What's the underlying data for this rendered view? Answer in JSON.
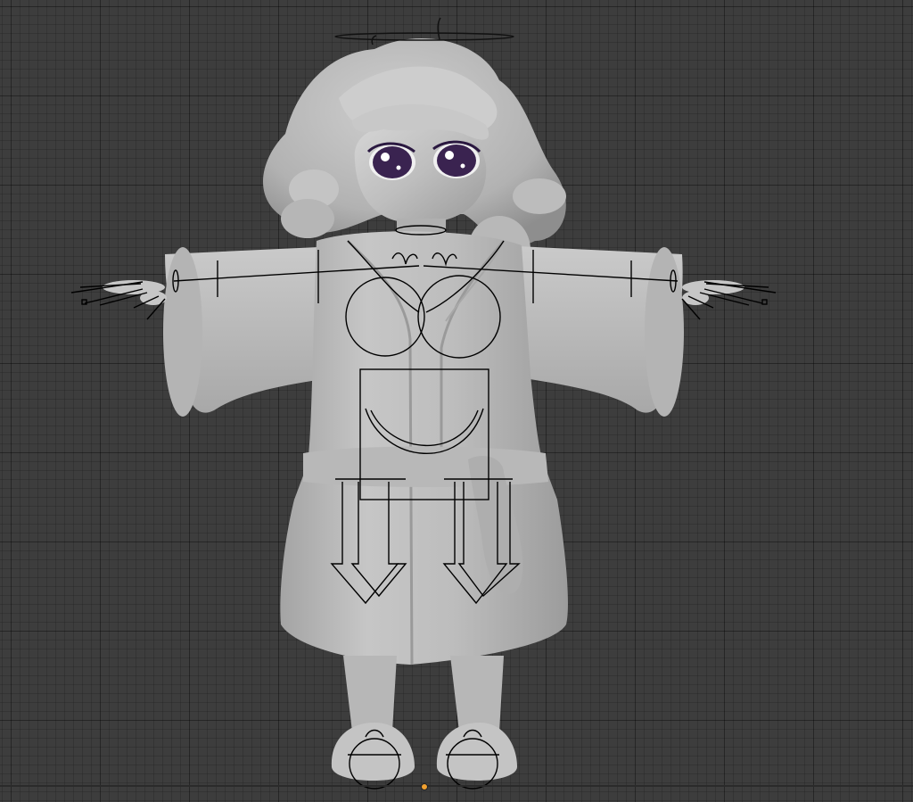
{
  "viewport": {
    "view": "front-orthographic",
    "background_color": "#3d3d3d",
    "grid_color": "#303030",
    "origin_color": "#f0a030"
  },
  "model": {
    "shading": "solid",
    "mesh_color": "#bdbdbd",
    "eye_color": "#3a2350",
    "pose": "t-pose"
  },
  "rig": {
    "overlay_color": "#000000",
    "controls": [
      "halo",
      "eye-controls",
      "shoulder-controls",
      "chest-circles",
      "torso-box",
      "belt-control",
      "leg-arrows",
      "foot-circles",
      "finger-controls"
    ]
  }
}
